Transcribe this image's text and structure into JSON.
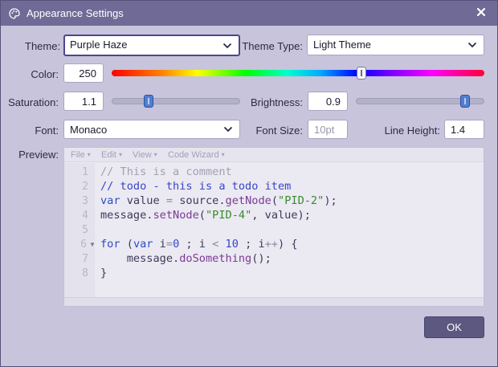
{
  "window": {
    "title": "Appearance Settings",
    "app_icon": "palette-icon",
    "close_icon": "close-icon"
  },
  "theme": {
    "label": "Theme:",
    "value": "Purple Haze"
  },
  "theme_type": {
    "label": "Theme Type:",
    "value": "Light Theme"
  },
  "color": {
    "label": "Color:",
    "value": "250",
    "slider_fraction": 0.67
  },
  "saturation": {
    "label": "Saturation:",
    "value": "1.1",
    "slider_fraction": 0.29
  },
  "brightness": {
    "label": "Brightness:",
    "value": "0.9",
    "slider_fraction": 0.85
  },
  "font": {
    "label": "Font:",
    "value": "Monaco"
  },
  "font_size": {
    "label": "Font Size:",
    "placeholder": "10pt"
  },
  "line_height": {
    "label": "Line Height:",
    "value": "1.4"
  },
  "preview": {
    "label": "Preview:",
    "menu": [
      "File",
      "Edit",
      "View",
      "Code Wizard"
    ],
    "line_numbers": [
      "1",
      "2",
      "3",
      "4",
      "5",
      "6",
      "7",
      "8"
    ],
    "code": {
      "l1": "// This is a comment",
      "l2": "// todo - this is a todo item",
      "l3_kw": "var",
      "l3_a": " value ",
      "l3_op": "=",
      "l3_b": " source.",
      "l3_fn": "getNode",
      "l3_c": "(",
      "l3_str": "\"PID-2\"",
      "l3_d": ");",
      "l4_a": "message.",
      "l4_fn": "setNode",
      "l4_b": "(",
      "l4_str": "\"PID-4\"",
      "l4_c": ", value);",
      "l6_kw": "for",
      "l6_a": " (",
      "l6_kw2": "var",
      "l6_b": " i",
      "l6_op1": "=",
      "l6_n1": "0",
      "l6_c": " ; i ",
      "l6_op2": "<",
      "l6_d": " ",
      "l6_n2": "10",
      "l6_e": " ; i",
      "l6_op3": "++",
      "l6_f": ") {",
      "l7_a": "    message.",
      "l7_fn": "doSomething",
      "l7_b": "();",
      "l8": "}"
    }
  },
  "ok_label": "OK",
  "colors": {
    "titlebar": "#6f6b96",
    "dialog_bg": "#c7c4dc",
    "ok_button": "#5c5880",
    "slider_thumb": "#4f7fd3"
  }
}
